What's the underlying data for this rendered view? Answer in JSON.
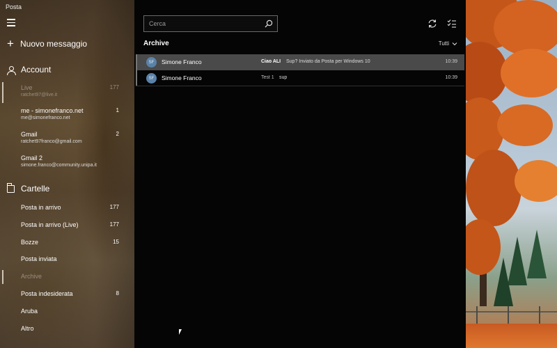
{
  "app": {
    "title": "Posta"
  },
  "sidebar": {
    "new_message_label": "Nuovo messaggio",
    "accounts_header": "Account",
    "accounts": [
      {
        "name": "Live",
        "email": "ratchet97@live.it",
        "count": "177",
        "active": true
      },
      {
        "name": "me - simonefranco.net",
        "email": "me@simonefranco.net",
        "count": "1",
        "active": false
      },
      {
        "name": "Gmail",
        "email": "ratchet97franco@gmail.com",
        "count": "2",
        "active": false
      },
      {
        "name": "Gmail 2",
        "email": "simone.franco@community.unipa.it",
        "count": "",
        "active": false
      }
    ],
    "folders_header": "Cartelle",
    "folders": [
      {
        "name": "Posta in arrivo",
        "count": "177",
        "active": false
      },
      {
        "name": "Posta in arrivo (Live)",
        "count": "177",
        "active": false
      },
      {
        "name": "Bozze",
        "count": "15",
        "active": false
      },
      {
        "name": "Posta inviata",
        "count": "",
        "active": false
      },
      {
        "name": "Archive",
        "count": "",
        "active": true
      },
      {
        "name": "Posta indesiderata",
        "count": "8",
        "active": false
      },
      {
        "name": "Aruba",
        "count": "",
        "active": false
      },
      {
        "name": "Altro",
        "count": "",
        "active": false
      }
    ]
  },
  "main": {
    "search_placeholder": "Cerca",
    "folder_title": "Archive",
    "filter_label": "Tutti",
    "messages": [
      {
        "initials": "SF",
        "sender": "Simone Franco",
        "subject": "Ciao ALI",
        "preview": "Sup? Inviato da Posta per Windows 10",
        "time": "10:39",
        "selected": true
      },
      {
        "initials": "SF",
        "sender": "Simone Franco",
        "subject": "Test 1",
        "preview": "sup",
        "time": "10:39",
        "selected": false
      }
    ]
  },
  "colors": {
    "accent_avatar": "#5a82a8",
    "selected_row": "#4a4a4a",
    "main_background": "#050505"
  },
  "icons": [
    "hamburger-icon",
    "plus-icon",
    "person-icon",
    "folder-icon",
    "search-icon",
    "sync-icon",
    "select-mode-icon",
    "chevron-down-icon"
  ]
}
